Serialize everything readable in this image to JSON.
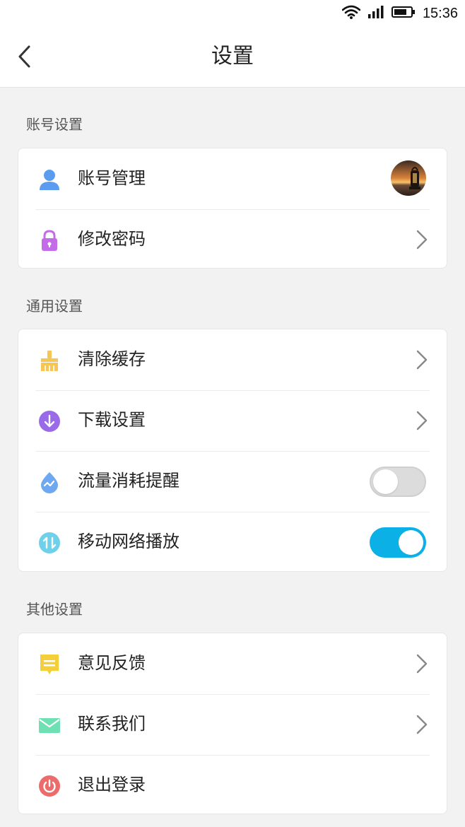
{
  "status_bar": {
    "time": "15:36"
  },
  "header": {
    "title": "设置"
  },
  "sections": [
    {
      "title": "账号设置",
      "items": [
        {
          "label": "账号管理",
          "icon": "user-icon",
          "control": "avatar"
        },
        {
          "label": "修改密码",
          "icon": "lock-icon",
          "control": "chevron"
        }
      ]
    },
    {
      "title": "通用设置",
      "items": [
        {
          "label": "清除缓存",
          "icon": "broom-icon",
          "control": "chevron"
        },
        {
          "label": "下载设置",
          "icon": "download-icon",
          "control": "chevron"
        },
        {
          "label": "流量消耗提醒",
          "icon": "data-usage-icon",
          "control": "toggle",
          "toggle_on": false
        },
        {
          "label": "移动网络播放",
          "icon": "network-transfer-icon",
          "control": "toggle",
          "toggle_on": true
        }
      ]
    },
    {
      "title": "其他设置",
      "items": [
        {
          "label": "意见反馈",
          "icon": "feedback-icon",
          "control": "chevron"
        },
        {
          "label": "联系我们",
          "icon": "mail-icon",
          "control": "chevron"
        },
        {
          "label": "退出登录",
          "icon": "power-icon",
          "control": "none"
        }
      ]
    }
  ],
  "colors": {
    "accent": "#0ab0e6",
    "background": "#f2f2f2",
    "user_icon": "#5b9cf0",
    "lock_icon": "#c46be8",
    "broom_icon": "#f6c654",
    "download_icon": "#9a6be8",
    "data_usage_icon": "#6ea8f0",
    "network_icon": "#6fd0ea",
    "feedback_icon": "#f4cf3a",
    "mail_icon": "#6ee0b4",
    "power_icon": "#ec6b6b"
  }
}
